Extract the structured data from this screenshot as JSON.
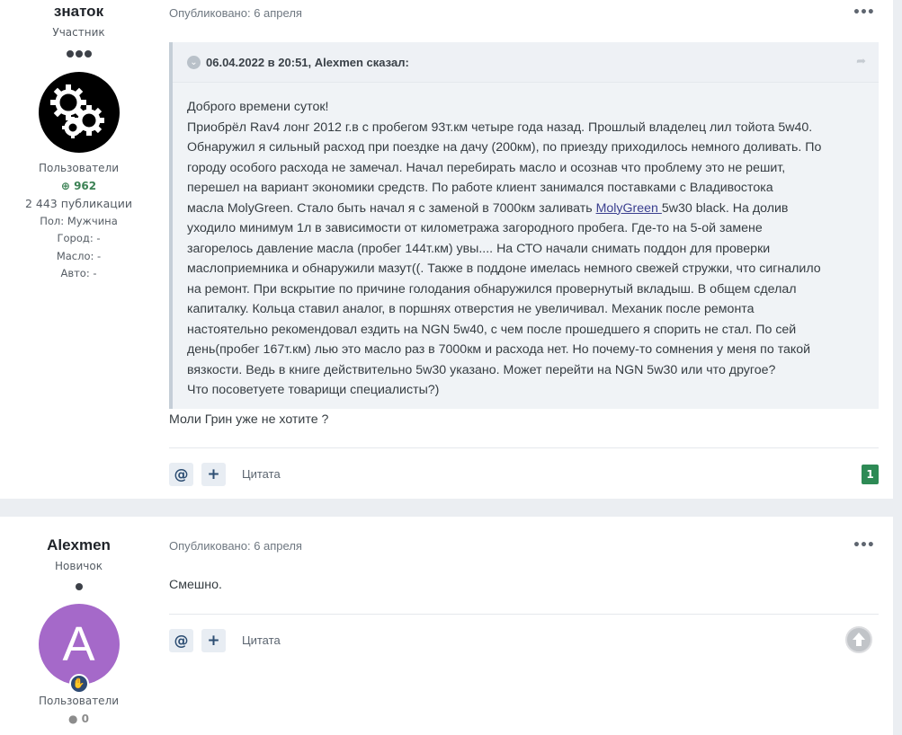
{
  "posts": [
    {
      "author": {
        "name": "знаток",
        "rank": "Участник",
        "group": "Пользователи",
        "reputation": "962",
        "posts_count": "2 443 публикации",
        "gender": "Пол: Мужчина",
        "city": "Город: -",
        "oil": "Масло: -",
        "car": "Авто: -"
      },
      "date": "Опубликовано: 6 апреля",
      "quote": {
        "cite": "06.04.2022 в 20:51, Alexmen сказал:",
        "lines": [
          "Доброго времени суток!",
          "Приобрёл Rav4 лонг 2012 г.в с пробегом 93т.км четыре года назад. Прошлый владелец лил тойота 5w40.",
          "Обнаружил я сильный расход при поездке на дачу (200км), по приезду приходилось немного доливать. По",
          "городу особого расхода не замечал. Начал перебирать масло и осознав что проблему это не решит,",
          "перешел на вариант экономики средств. По работе клиент занимался поставками с Владивостока",
          "масла MolyGreen. Стало быть начал я с заменой в 7000км заливать ",
          "уходило минимум 1л в зависимости от километража загородного пробега. Где-то на 5-ой замене",
          "загорелось давление масла (пробег 144т.км) увы....  На СТО начали снимать поддон для проверки",
          "маслоприемника и обнаружили мазут((. Также в поддоне имелась немного свежей стружки, что сигналило",
          "на ремонт. При вскрытие по причине голодания обнаружился провернутый вкладыш. В общем сделал",
          "капиталку. Кольца ставил аналог, в поршнях отверстия не увеличивал. Механик после ремонта",
          "настоятельно рекомендовал ездить на NGN 5w40, с чем после прошедшего я спорить не стал. По сей",
          "день(пробег 167т.км) лью это масло раз в 7000км и расхода нет. Но почему-то сомнения у меня по такой",
          "вязкости. Ведь в книге действительно 5w30 указано. Может перейти на NGN 5w30 или что другое?",
          "Что посоветуете товарищи специалисты?)"
        ],
        "link_text": "MolyGreen ",
        "link_after": "5w30 black. На долив"
      },
      "reply": "Моли Грин уже не хотите ?",
      "quote_label": "Цитата",
      "rep_count": "1"
    },
    {
      "author": {
        "name": "Alexmen",
        "rank": "Новичок",
        "avatar_letter": "A",
        "group": "Пользователи",
        "reputation": "0"
      },
      "date": "Опубликовано: 6 апреля",
      "reply": "Смешно.",
      "quote_label": "Цитата"
    }
  ],
  "colors": {
    "accent_green": "#2d8a55",
    "avatar_purple": "#a569c9",
    "link": "#3a3f8f"
  },
  "icons": {
    "mention": "@",
    "plus": "+",
    "menu": "•••",
    "toggle": "chevron-down",
    "share": "share-arrow"
  }
}
